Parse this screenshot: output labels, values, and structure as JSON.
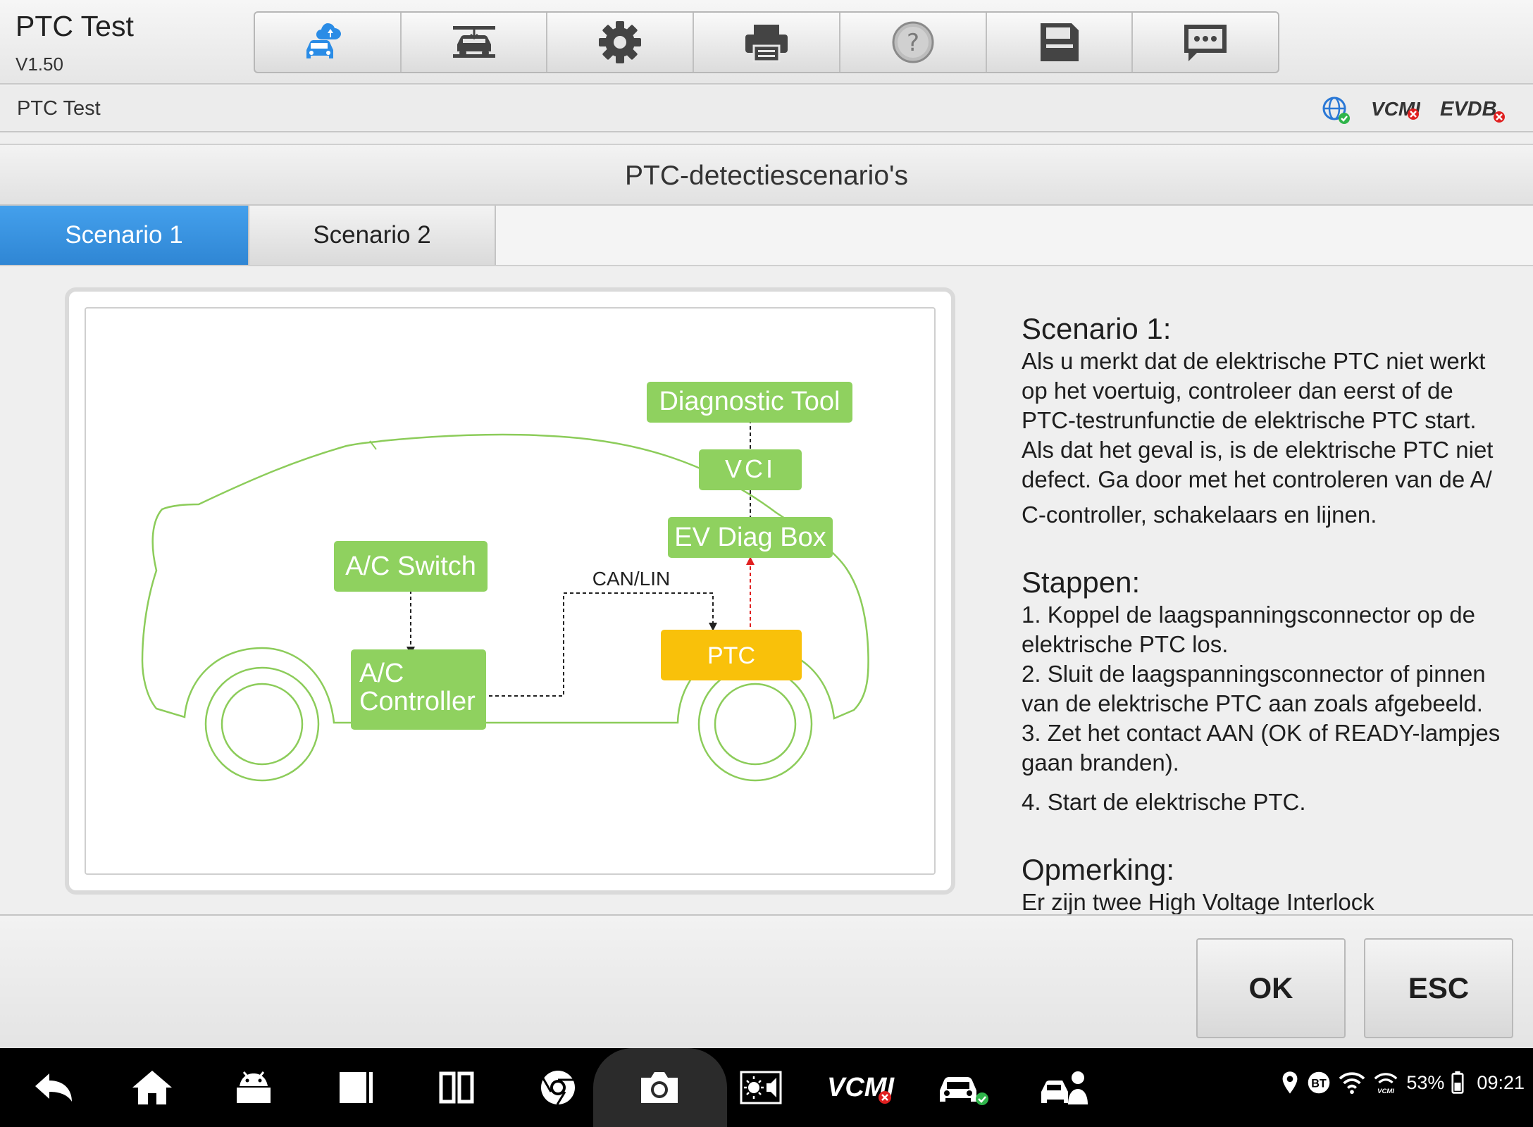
{
  "header": {
    "title": "PTC Test",
    "version": "V1.50",
    "toolbar": [
      {
        "icon": "car-cloud-icon"
      },
      {
        "icon": "lift-icon"
      },
      {
        "icon": "gear-icon"
      },
      {
        "icon": "printer-icon"
      },
      {
        "icon": "help-icon"
      },
      {
        "icon": "save-icon"
      },
      {
        "icon": "chat-icon"
      }
    ]
  },
  "subheader": {
    "breadcrumb": "PTC Test",
    "status": {
      "vcmi": "VCMI",
      "evdb": "EVDB"
    }
  },
  "section": {
    "title": "PTC-detectiescenario's"
  },
  "tabs": [
    {
      "label": "Scenario 1",
      "active": true
    },
    {
      "label": "Scenario 2",
      "active": false
    }
  ],
  "diagram": {
    "diagnostic_tool": "Diagnostic Tool",
    "vci": "VCI",
    "ev_diag_box": "EV Diag Box",
    "ac_switch": "A/C Switch",
    "ac_controller_line1": "A/C",
    "ac_controller_line2": "Controller",
    "can_lin": "CAN/LIN",
    "ptc": "PTC",
    "colors": {
      "green": "#8fd15f",
      "orange": "#f9c10a",
      "outline": "#8ccc5a",
      "red_line": "#e02020"
    }
  },
  "description": {
    "scenario_heading": "Scenario 1:",
    "scenario_lines": [
      "Als u merkt dat de elektrische PTC niet werkt",
      "op het voertuig, controleer dan eerst of de",
      "PTC-testrunfunctie de elektrische PTC start.",
      "Als dat het geval is, is de elektrische PTC niet",
      "defect. Ga door met het controleren van de A/",
      "C-controller, schakelaars en lijnen."
    ],
    "steps_heading": "Stappen:",
    "steps_lines": [
      "1. Koppel de laagspanningsconnector op de",
      "elektrische PTC los.",
      "2. Sluit de laagspanningsconnector of pinnen",
      "van de elektrische PTC aan zoals afgebeeld.",
      "3. Zet het contact AAN (OK of READY-lampjes",
      "gaan branden).",
      "4. Start de elektrische PTC."
    ],
    "note_heading": "Opmerking:",
    "note_partial": "Er zijn twee High Voltage Interlock"
  },
  "footer": {
    "ok": "OK",
    "esc": "ESC"
  },
  "navbar": {
    "vcmi": "VCMI",
    "battery": "53%",
    "time": "09:21",
    "bt": "BT"
  }
}
